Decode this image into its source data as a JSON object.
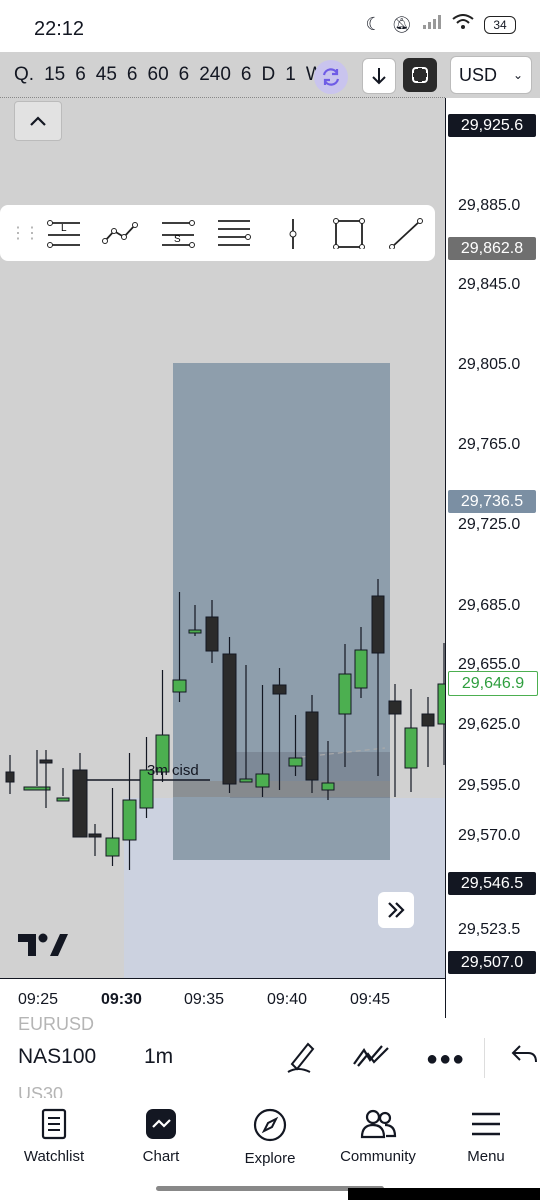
{
  "status_bar": {
    "time": "22:12",
    "battery": "34"
  },
  "toolbar_top": {
    "intervals": [
      "Q.",
      "15",
      "6",
      "45",
      "6",
      "60",
      "6",
      "240",
      "6",
      "D",
      "1",
      "W",
      "1"
    ],
    "currency": "USD"
  },
  "price_axis": {
    "labels": [
      "29,885.0",
      "29,845.0",
      "29,805.0",
      "29,765.0",
      "29,725.0",
      "29,685.0",
      "29,655.0",
      "29,625.0",
      "29,595.0",
      "29,570.0",
      "29,523.5"
    ],
    "tags": {
      "top": "29,925.6",
      "stop": "29,862.8",
      "mid": "29,736.5",
      "last": "29,646.9",
      "entry": "29,546.5",
      "low": "29,507.0"
    }
  },
  "time_axis": {
    "labels": [
      "09:25",
      "09:30",
      "09:35",
      "09:40",
      "09:45"
    ]
  },
  "annotation": "3m cisd",
  "symbol_bar": {
    "prev_symbol": "EURUSD",
    "symbol": "NAS100",
    "next_symbol": "US30",
    "timeframe": "1m"
  },
  "nav": {
    "items": [
      "Watchlist",
      "Chart",
      "Explore",
      "Community",
      "Menu"
    ]
  },
  "colors": {
    "up": "#4caf50",
    "down": "#2b2b2b",
    "accent": "#6f5ce6",
    "box": "#8e9eac"
  }
}
